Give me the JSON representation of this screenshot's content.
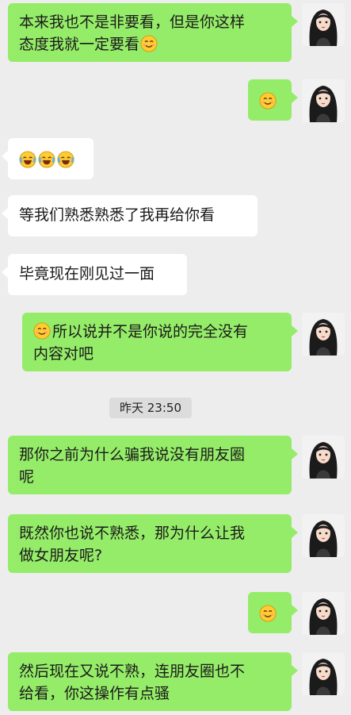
{
  "chat": {
    "messages": [
      {
        "side": "right",
        "line1": "本来我也不是非要看，但是你这样",
        "line2": "态度我就一定要看"
      },
      {
        "side": "right",
        "emoji": "smile"
      },
      {
        "side": "left",
        "emojis": [
          "cry-laugh",
          "cry-laugh",
          "cry-laugh"
        ]
      },
      {
        "side": "left",
        "text": "等我们熟悉熟悉了我再给你看"
      },
      {
        "side": "left",
        "text": "毕竟现在刚见过一面"
      },
      {
        "side": "right",
        "line1": "所以说并不是你说的完全没有",
        "line2": "内容对吧"
      },
      {
        "side": "right",
        "line1": "那你之前为什么骗我说没有朋友圈",
        "line2": "呢"
      },
      {
        "side": "right",
        "line1": "既然你也说不熟悉，那为什么让我",
        "line2": "做女朋友呢?"
      },
      {
        "side": "right",
        "emoji": "smile"
      },
      {
        "side": "right",
        "line1": "然后现在又说不熟，连朋友圈也不",
        "line2": "给看，你这操作有点骚"
      }
    ],
    "timestamp": "昨天 23:50"
  },
  "colors": {
    "background": "#ededed",
    "sent_bubble": "#95ec69",
    "received_bubble": "#ffffff",
    "timestamp_bg": "#dcdcdc"
  }
}
